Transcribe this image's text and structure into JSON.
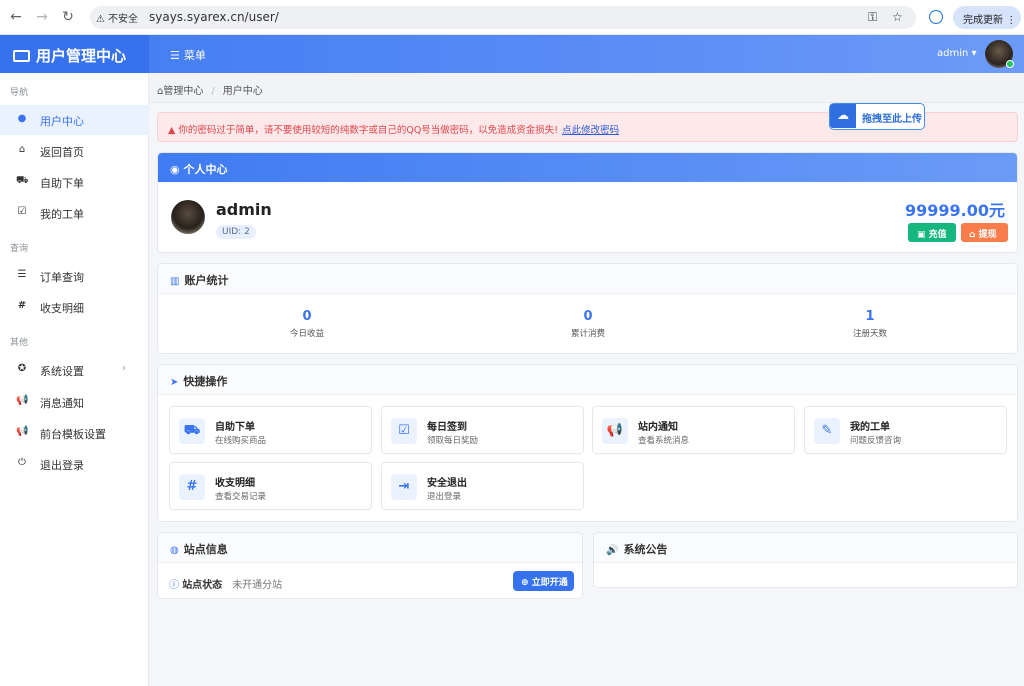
{
  "browser": {
    "insecure_label": "不安全",
    "url": "syays.syarex.cn/user/",
    "update_label": "完成更新"
  },
  "header": {
    "brand": "用户管理中心",
    "menu_label": "菜单",
    "username": "admin"
  },
  "sidebar": {
    "sections": [
      "导航",
      "查询",
      "其他"
    ],
    "items": [
      {
        "label": "用户中心",
        "icon": "user-icon",
        "active": true
      },
      {
        "label": "返回首页",
        "icon": "home-icon"
      },
      {
        "label": "自助下单",
        "icon": "cart-icon"
      },
      {
        "label": "我的工单",
        "icon": "check-square-icon"
      },
      {
        "label": "订单查询",
        "icon": "list-icon"
      },
      {
        "label": "收支明细",
        "icon": "hash-icon"
      },
      {
        "label": "系统设置",
        "icon": "rebel-icon"
      },
      {
        "label": "消息通知",
        "icon": "bullhorn-icon"
      },
      {
        "label": "前台模板设置",
        "icon": "bullhorn-icon"
      },
      {
        "label": "退出登录",
        "icon": "power-icon"
      }
    ]
  },
  "breadcrumb": {
    "home": "管理中心",
    "current": "用户中心"
  },
  "alert": {
    "text": "你的密码过于简单，请不要使用较短的纯数字或自己的QQ号当做密码，以免造成资金损失!",
    "link": "点此修改密码"
  },
  "upload_badge": "拖拽至此上传",
  "profile": {
    "title": "个人中心",
    "name": "admin",
    "uid": "UID: 2",
    "balance": "99999.00元",
    "recharge": "充值",
    "withdraw": "提现"
  },
  "stats": {
    "title": "账户统计",
    "items": [
      {
        "value": "0",
        "label": "今日收益"
      },
      {
        "value": "0",
        "label": "累计消费"
      },
      {
        "value": "1",
        "label": "注册天数"
      }
    ]
  },
  "quick": {
    "title": "快捷操作",
    "items": [
      {
        "title": "自助下单",
        "sub": "在线购买商品",
        "icon": "cart-icon"
      },
      {
        "title": "每日签到",
        "sub": "领取每日奖励",
        "icon": "check-square-icon"
      },
      {
        "title": "站内通知",
        "sub": "查看系统消息",
        "icon": "bullhorn-icon"
      },
      {
        "title": "我的工单",
        "sub": "问题反馈咨询",
        "icon": "edit-square-icon"
      },
      {
        "title": "收支明细",
        "sub": "查看交易记录",
        "icon": "hash-icon"
      },
      {
        "title": "安全退出",
        "sub": "退出登录",
        "icon": "sign-out-icon"
      }
    ]
  },
  "site": {
    "title": "站点信息",
    "status_label": "站点状态",
    "status_value": "未开通分站",
    "open_button": "立即开通"
  },
  "notice": {
    "title": "系统公告"
  }
}
